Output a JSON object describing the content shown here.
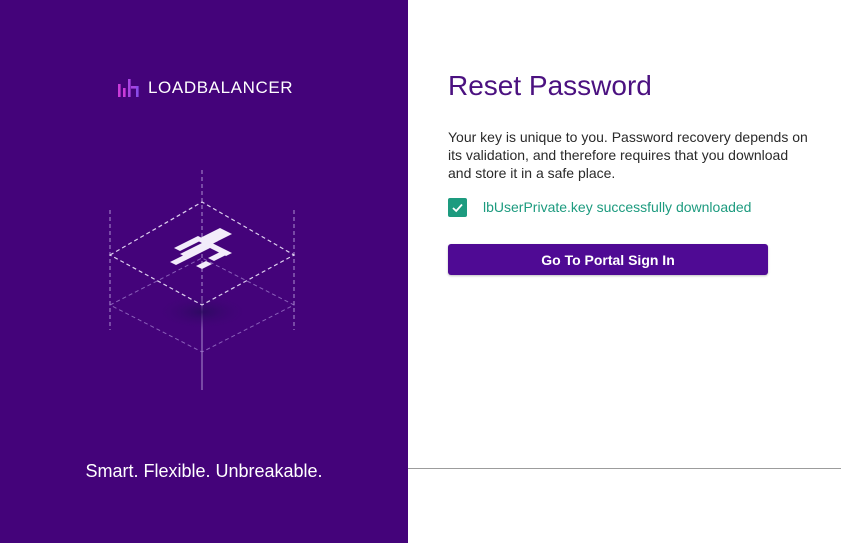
{
  "brand": {
    "name": "LOADBALANCER",
    "icon": "bar-chart-logo-icon",
    "icon_colors": [
      "#c93bd9",
      "#8a4be8"
    ]
  },
  "hero": {
    "illustration_icon": "layered-cube-logo-icon",
    "tagline": "Smart. Flexible. Unbreakable."
  },
  "form": {
    "title": "Reset Password",
    "description": "Your key is unique to you. Password recovery depends on its validation, and therefore requires that you download and store it in a safe place.",
    "status": {
      "icon": "check-icon",
      "text": "lbUserPrivate.key successfully downloaded"
    },
    "primary_button_label": "Go To Portal Sign In"
  },
  "colors": {
    "left_panel_bg": "#44037a",
    "title": "#4b1180",
    "success": "#1d9b7f",
    "button_bg": "#4f0a94"
  }
}
